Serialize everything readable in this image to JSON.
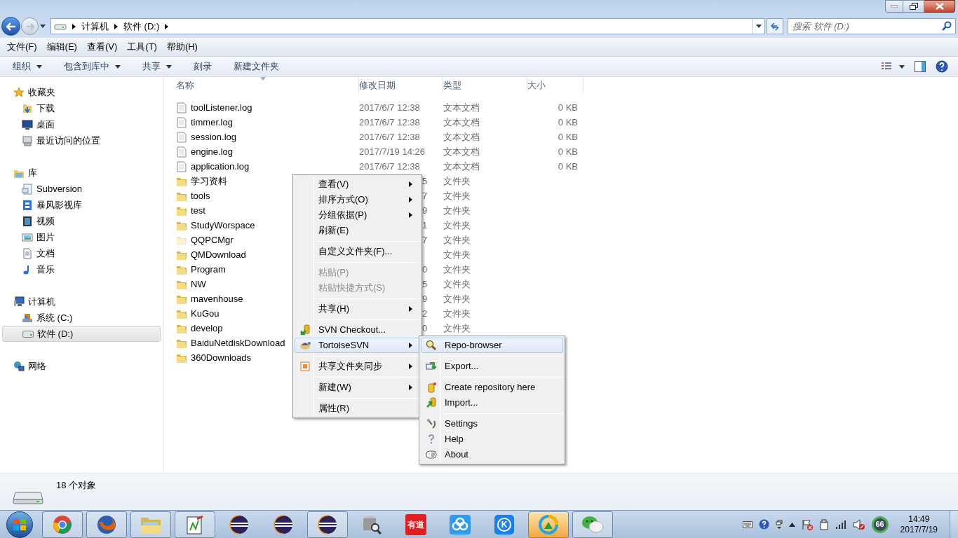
{
  "address_bar": {
    "breadcrumbs": [
      "计算机",
      "软件 (D:)"
    ]
  },
  "search": {
    "placeholder": "搜索 软件 (D:)"
  },
  "menu_bar": [
    "文件(F)",
    "编辑(E)",
    "查看(V)",
    "工具(T)",
    "帮助(H)"
  ],
  "command_bar": [
    {
      "label": "组织",
      "dropdown": true
    },
    {
      "label": "包含到库中",
      "dropdown": true
    },
    {
      "label": "共享",
      "dropdown": true
    },
    {
      "label": "刻录",
      "dropdown": false
    },
    {
      "label": "新建文件夹",
      "dropdown": false
    }
  ],
  "sidebar": {
    "groups": [
      {
        "label": "收藏夹",
        "selected": false,
        "children": [
          {
            "label": "下载",
            "selected": false
          },
          {
            "label": "桌面",
            "selected": false
          },
          {
            "label": "最近访问的位置",
            "selected": false
          }
        ]
      },
      {
        "label": "库",
        "selected": false,
        "children": [
          {
            "label": "Subversion",
            "selected": false
          },
          {
            "label": "暴风影视库",
            "selected": false
          },
          {
            "label": "视频",
            "selected": false
          },
          {
            "label": "图片",
            "selected": false
          },
          {
            "label": "文档",
            "selected": false
          },
          {
            "label": "音乐",
            "selected": false
          }
        ]
      },
      {
        "label": "计算机",
        "selected": false,
        "children": [
          {
            "label": "系统 (C:)",
            "selected": false
          },
          {
            "label": "软件 (D:)",
            "selected": true
          }
        ]
      },
      {
        "label": "网络",
        "selected": false
      }
    ]
  },
  "table": {
    "columns": [
      "名称",
      "修改日期",
      "类型",
      "大小"
    ],
    "rows": [
      {
        "kind": "file",
        "name": "toolListener.log",
        "modified": "2017/6/7 12:38",
        "type": "文本文档",
        "size": "0 KB",
        "dimmed": false
      },
      {
        "kind": "file",
        "name": "timmer.log",
        "modified": "2017/6/7 12:38",
        "type": "文本文档",
        "size": "0 KB",
        "dimmed": false
      },
      {
        "kind": "file",
        "name": "session.log",
        "modified": "2017/6/7 12:38",
        "type": "文本文档",
        "size": "0 KB",
        "dimmed": false
      },
      {
        "kind": "file",
        "name": "engine.log",
        "modified": "2017/7/19 14:26",
        "type": "文本文档",
        "size": "0 KB",
        "dimmed": false
      },
      {
        "kind": "file",
        "name": "application.log",
        "modified": "2017/6/7 12:38",
        "type": "文本文档",
        "size": "0 KB",
        "dimmed": false
      },
      {
        "kind": "folder",
        "name": "学习资料",
        "modified": "5",
        "type": "文件夹",
        "dimmed": false
      },
      {
        "kind": "folder",
        "name": "tools",
        "modified": "7",
        "type": "文件夹",
        "dimmed": false
      },
      {
        "kind": "folder",
        "name": "test",
        "modified": "9",
        "type": "文件夹",
        "dimmed": false
      },
      {
        "kind": "folder",
        "name": "StudyWorspace",
        "modified": "1",
        "type": "文件夹",
        "dimmed": false
      },
      {
        "kind": "folder",
        "name": "QQPCMgr",
        "modified": "7",
        "type": "文件夹",
        "dimmed": true
      },
      {
        "kind": "folder",
        "name": "QMDownload",
        "type": "文件夹",
        "dimmed": false
      },
      {
        "kind": "folder",
        "name": "Program",
        "modified": "0",
        "type": "文件夹",
        "dimmed": false
      },
      {
        "kind": "folder",
        "name": "NW",
        "modified": "5",
        "type": "文件夹",
        "dimmed": false
      },
      {
        "kind": "folder",
        "name": "mavenhouse",
        "modified": "9",
        "type": "文件夹",
        "dimmed": false
      },
      {
        "kind": "folder",
        "name": "KuGou",
        "modified": "2",
        "type": "文件夹",
        "dimmed": false
      },
      {
        "kind": "folder",
        "name": "develop",
        "modified": "0",
        "type": "文件夹",
        "dimmed": false
      },
      {
        "kind": "folder",
        "name": "BaiduNetdiskDownload",
        "dimmed": false
      },
      {
        "kind": "folder",
        "name": "360Downloads",
        "dimmed": false
      }
    ]
  },
  "context_menu": {
    "items": [
      {
        "kind": "item",
        "label": "查看(V)",
        "submenu": true,
        "disabled": false,
        "selected": false
      },
      {
        "kind": "item",
        "label": "排序方式(O)",
        "submenu": true,
        "disabled": false,
        "selected": false
      },
      {
        "kind": "item",
        "label": "分组依据(P)",
        "submenu": true,
        "disabled": false,
        "selected": false
      },
      {
        "kind": "item",
        "label": "刷新(E)",
        "submenu": false,
        "disabled": false,
        "selected": false
      },
      {
        "kind": "separator"
      },
      {
        "kind": "item",
        "label": "自定义文件夹(F)...",
        "submenu": false,
        "disabled": false,
        "selected": false
      },
      {
        "kind": "separator"
      },
      {
        "kind": "item",
        "label": "粘贴(P)",
        "submenu": false,
        "disabled": true,
        "selected": false
      },
      {
        "kind": "item",
        "label": "粘贴快捷方式(S)",
        "submenu": false,
        "disabled": true,
        "selected": false
      },
      {
        "kind": "separator"
      },
      {
        "kind": "item",
        "label": "共享(H)",
        "submenu": true,
        "disabled": false,
        "selected": false
      },
      {
        "kind": "separator"
      },
      {
        "kind": "item",
        "label": "SVN Checkout...",
        "submenu": false,
        "disabled": false,
        "selected": false
      },
      {
        "kind": "item",
        "label": "TortoiseSVN",
        "submenu": true,
        "disabled": false,
        "selected": true
      },
      {
        "kind": "separator"
      },
      {
        "kind": "item",
        "label": "共享文件夹同步",
        "submenu": true,
        "disabled": false,
        "selected": false
      },
      {
        "kind": "separator"
      },
      {
        "kind": "item",
        "label": "新建(W)",
        "submenu": true,
        "disabled": false,
        "selected": false
      },
      {
        "kind": "separator"
      },
      {
        "kind": "item",
        "label": "属性(R)",
        "submenu": false,
        "disabled": false,
        "selected": false
      }
    ]
  },
  "submenu": {
    "items": [
      {
        "kind": "item",
        "label": "Repo-browser",
        "selected": true
      },
      {
        "kind": "separator"
      },
      {
        "kind": "item",
        "label": "Export...",
        "selected": false
      },
      {
        "kind": "separator"
      },
      {
        "kind": "item",
        "label": "Create repository here",
        "selected": false
      },
      {
        "kind": "item",
        "label": "Import...",
        "selected": false
      },
      {
        "kind": "separator"
      },
      {
        "kind": "item",
        "label": "Settings",
        "selected": false
      },
      {
        "kind": "item",
        "label": "Help",
        "selected": false
      },
      {
        "kind": "item",
        "label": "About",
        "selected": false
      }
    ]
  },
  "details_pane": {
    "count": "18 个对象"
  },
  "taskbar": {
    "apps": [
      {
        "running": true,
        "attention": false
      },
      {
        "running": true,
        "attention": false
      },
      {
        "running": true,
        "attention": false
      },
      {
        "running": true,
        "attention": false
      },
      {
        "running": false,
        "attention": false
      },
      {
        "running": false,
        "attention": false
      },
      {
        "running": true,
        "attention": false
      },
      {
        "running": false,
        "attention": false
      },
      {
        "running": false,
        "attention": false,
        "label": "有道"
      },
      {
        "running": false,
        "attention": false
      },
      {
        "running": false,
        "attention": false,
        "label": "K"
      },
      {
        "running": true,
        "attention": true
      },
      {
        "running": true,
        "attention": false
      }
    ],
    "tray": {
      "badge": "66",
      "time": "14:49",
      "date": "2017/7/19"
    }
  }
}
